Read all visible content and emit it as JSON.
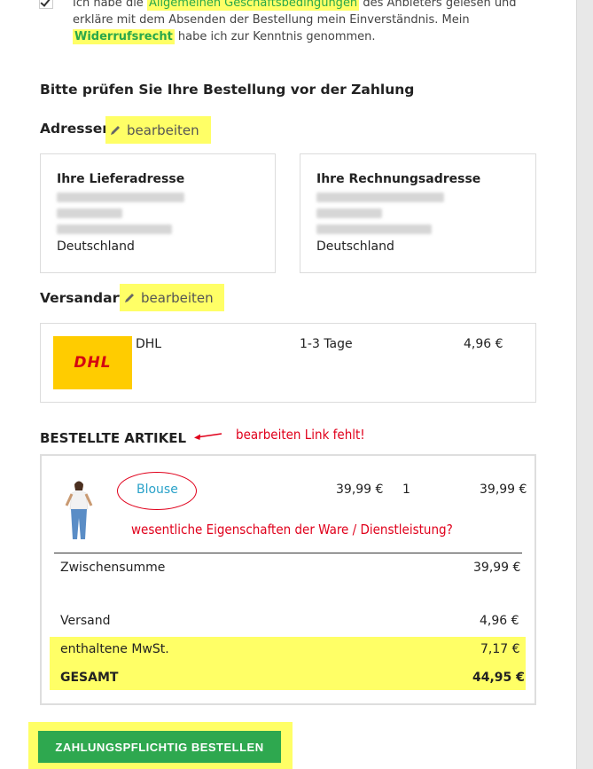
{
  "consent": {
    "text_before": "Ich habe die ",
    "agb_link": "Allgemeinen Geschäftsbedingungen",
    "text_middle": " des Anbieters gelesen und erkläre mit dem Absenden der Bestellung mein Einverständnis. Mein ",
    "widerruf_link": "Widerrufsrecht",
    "text_after": " habe ich zur Kenntnis genommen."
  },
  "review_title": "Bitte prüfen Sie Ihre Bestellung vor der Zahlung",
  "addresses": {
    "title": "Adressen",
    "edit_label": "bearbeiten",
    "shipping": {
      "title": "Ihre Lieferadresse",
      "country": "Deutschland"
    },
    "billing": {
      "title": "Ihre Rechnungsadresse",
      "country": "Deutschland"
    }
  },
  "shipping_method": {
    "title": "Versandart",
    "edit_label": "bearbeiten",
    "logo_text": "DHL",
    "carrier": "DHL",
    "delivery_time": "1-3 Tage",
    "price": "4,96 €"
  },
  "ordered_items": {
    "title": "BESTELLTE ARTIKEL",
    "annotation": "bearbeiten Link fehlt!",
    "items": [
      {
        "name": "Blouse",
        "unit_price": "39,99 €",
        "qty": "1",
        "total": "39,99 €"
      }
    ],
    "item_annotation": "wesentliche Eigenschaften der Ware / Dienstleistung?"
  },
  "totals": {
    "subtotal_label": "Zwischensumme",
    "subtotal": "39,99 €",
    "shipping_label": "Versand",
    "shipping": "4,96 €",
    "tax_label": "enthaltene MwSt.",
    "tax": "7,17 €",
    "total_label": "GESAMT",
    "total": "44,95 €"
  },
  "submit_button": "ZAHLUNGSPFLICHTIG BESTELLEN",
  "colors": {
    "accent_green": "#2ea84f",
    "highlight": "#ffff66",
    "link_blue": "#2aa2c9",
    "annotation_red": "#e0001b",
    "dhl_yellow": "#ffcc00",
    "dhl_red": "#d40511"
  }
}
